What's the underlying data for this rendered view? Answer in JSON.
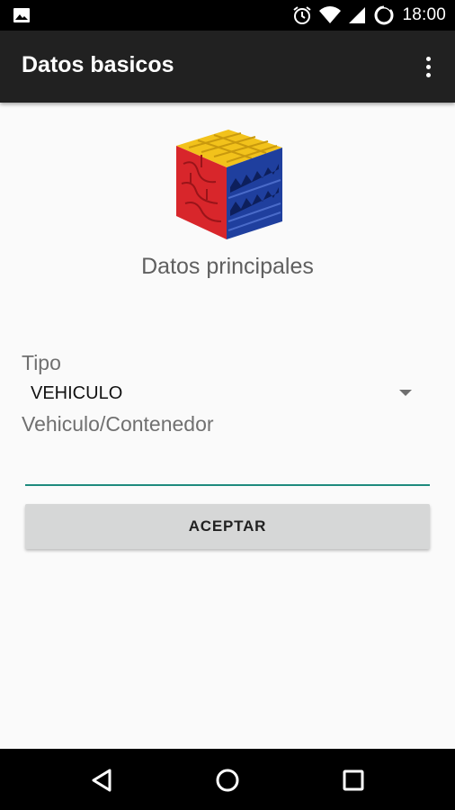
{
  "status_bar": {
    "time": "18:00",
    "icons": [
      "image-icon",
      "alarm-icon",
      "wifi-icon",
      "signal-icon",
      "battery-icon"
    ]
  },
  "app_bar": {
    "title": "Datos basicos",
    "menu_icon": "more-vert-icon"
  },
  "content": {
    "logo": "cube-logo",
    "subtitle": "Datos principales",
    "tipo_label": "Tipo",
    "tipo_value": "VEHICULO",
    "vehiculo_label": "Vehiculo/Contenedor",
    "vehiculo_value": "",
    "accept_label": "ACEPTAR"
  },
  "nav_bar": {
    "icons": [
      "back-icon",
      "home-icon",
      "recents-icon"
    ]
  },
  "colors": {
    "status_bar": "#000000",
    "app_bar": "#212121",
    "background": "#fafafa",
    "accent": "#1e8a7d",
    "button": "#d6d7d7",
    "logo_red": "#d8262b",
    "logo_yellow": "#f2c21b",
    "logo_blue": "#1f3f9e"
  }
}
